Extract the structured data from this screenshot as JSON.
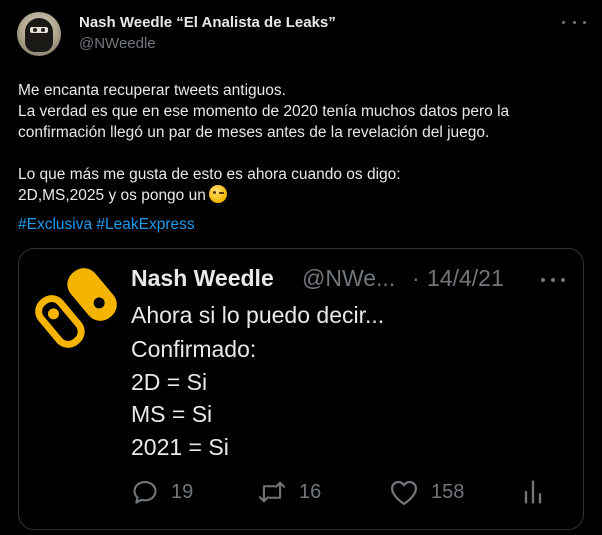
{
  "author": {
    "display_name": "Nash Weedle “El Analista de Leaks”",
    "handle": "@NWeedle",
    "avatar_icon": "avatar-masked-figure"
  },
  "tweet": {
    "lines": [
      "Me encanta recuperar tweets antiguos.",
      "La verdad es que en ese momento de 2020 tenía muchos datos pero la",
      "confirmación llegó un par de meses antes de la revelación del juego.",
      "Lo que más me gusta de esto es ahora cuando os digo:",
      "2D,MS,2025 y os pongo un"
    ],
    "emoji": "winking-face",
    "hashtags": [
      "#Exclusiva",
      "#LeakExpress"
    ]
  },
  "quoted": {
    "name": "Nash Weedle",
    "handle": "@NWe...",
    "separator": "·",
    "date": "14/4/21",
    "lines": [
      "Ahora si lo puedo decir...",
      "Confirmado:",
      "2D = Si",
      "MS = Si",
      "2021 = Si"
    ],
    "actions": {
      "replies": "19",
      "retweets": "16",
      "likes": "158"
    },
    "logo_icon": "switch-logo-icon"
  },
  "colors": {
    "background": "#000000",
    "text": "#e7e9ea",
    "muted": "#71767b",
    "link": "#1d9bf0",
    "logo_yellow": "#f5b400",
    "border": "#2f3336"
  }
}
